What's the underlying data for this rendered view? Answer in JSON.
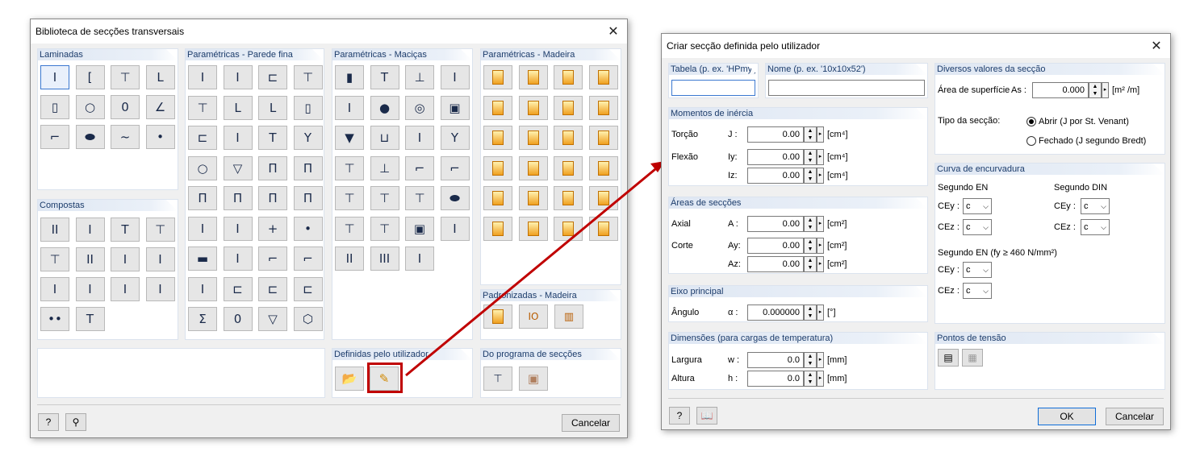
{
  "lib": {
    "title": "Biblioteca de secções transversais",
    "groups": {
      "laminadas": "Laminadas",
      "parede_fina": "Paramétricas - Parede fina",
      "macicas": "Paramétricas - Maciças",
      "madeira": "Paramétricas - Madeira",
      "compostas": "Compostas",
      "padronizadas": "Padronizadas - Madeira",
      "definidas": "Definidas pelo utilizador",
      "programa": "Do programa de secções"
    },
    "cancel": "Cancelar"
  },
  "laminadas": [
    "I",
    "[",
    "⊤",
    "L",
    "▯",
    "○",
    "0",
    "∠",
    "⌐",
    "⬬",
    "~",
    "•"
  ],
  "parede_fina": [
    "I",
    "I",
    "⊏",
    "⊤",
    "⊤",
    "L",
    "L",
    "▯",
    "⊏",
    "I",
    "T",
    "Y",
    "○",
    "▽",
    "Π",
    "Π",
    "Π",
    "Π",
    "Π",
    "Π",
    "I",
    "I",
    "+",
    "•",
    "▬",
    "I",
    "⌐",
    "⌐",
    "I",
    "⊏",
    "⊏",
    "⊏",
    "Σ",
    "0",
    "▽",
    "⬡"
  ],
  "compostas": [
    "II",
    "I",
    "T",
    "⊤",
    "⊤",
    "II",
    "I",
    "I",
    "I",
    "I",
    "I",
    "I",
    "••",
    "T"
  ],
  "macicas": [
    "▮",
    "T",
    "⊥",
    "I",
    "I",
    "●",
    "◎",
    "▣",
    "▼",
    "⊔",
    "I",
    "Y",
    "⊤",
    "⊥",
    "⌐",
    "⌐",
    "⊤",
    "⊤",
    "⊤",
    "⬬",
    "⊤",
    "⊤",
    "▣",
    "I",
    "II",
    "III",
    "I"
  ],
  "madeira_count": 24,
  "user": {
    "title": "Criar secção definida pelo utilizador",
    "tabela_label": "Tabela (p. ex. 'HPmy')",
    "nome_label": "Nome (p. ex. '10x10x52')",
    "tabela_value": "",
    "nome_value": "",
    "inercia": {
      "header": "Momentos de inércia",
      "torcao": "Torção",
      "J": "J :",
      "flexao": "Flexão",
      "Iy": "Iy:",
      "Iz": "Iz:",
      "J_val": "0.00",
      "Iy_val": "0.00",
      "Iz_val": "0.00",
      "unit": "[cm⁴]"
    },
    "areas": {
      "header": "Áreas de secções",
      "axial": "Axial",
      "A": "A :",
      "corte": "Corte",
      "Ay": "Ay:",
      "Az": "Az:",
      "A_val": "0.00",
      "Ay_val": "0.00",
      "Az_val": "0.00",
      "unit": "[cm²]"
    },
    "eixo": {
      "header": "Eixo principal",
      "angulo": "Ângulo",
      "alpha": "α :",
      "val": "0.000000",
      "unit": "[°]"
    },
    "dim": {
      "header": "Dimensões (para cargas de temperatura)",
      "largura": "Largura",
      "w": "w :",
      "altura": "Altura",
      "h": "h :",
      "w_val": "0.0",
      "h_val": "0.0",
      "unit": "[mm]"
    },
    "diversos": {
      "header": "Diversos valores da secção",
      "area_sup": "Área de superfície",
      "As": "As :",
      "As_val": "0.000",
      "As_unit": "[m² /m]",
      "tipo": "Tipo da secção:",
      "abrir": "Abrir (J por St. Venant)",
      "fechado": "Fechado (J segundo Bredt)"
    },
    "curva": {
      "header": "Curva de encurvadura",
      "en": "Segundo EN",
      "din": "Segundo DIN",
      "cey": "CEy :",
      "cez": "CEz :",
      "val": "c",
      "en460": "Segundo EN (fy ≥ 460 N/mm²)"
    },
    "pontos": {
      "header": "Pontos de tensão"
    },
    "ok": "OK",
    "cancel": "Cancelar"
  },
  "colors": {
    "accent": "#3b78d0",
    "arrow": "#c00000",
    "header_text": "#1c3c6b"
  }
}
